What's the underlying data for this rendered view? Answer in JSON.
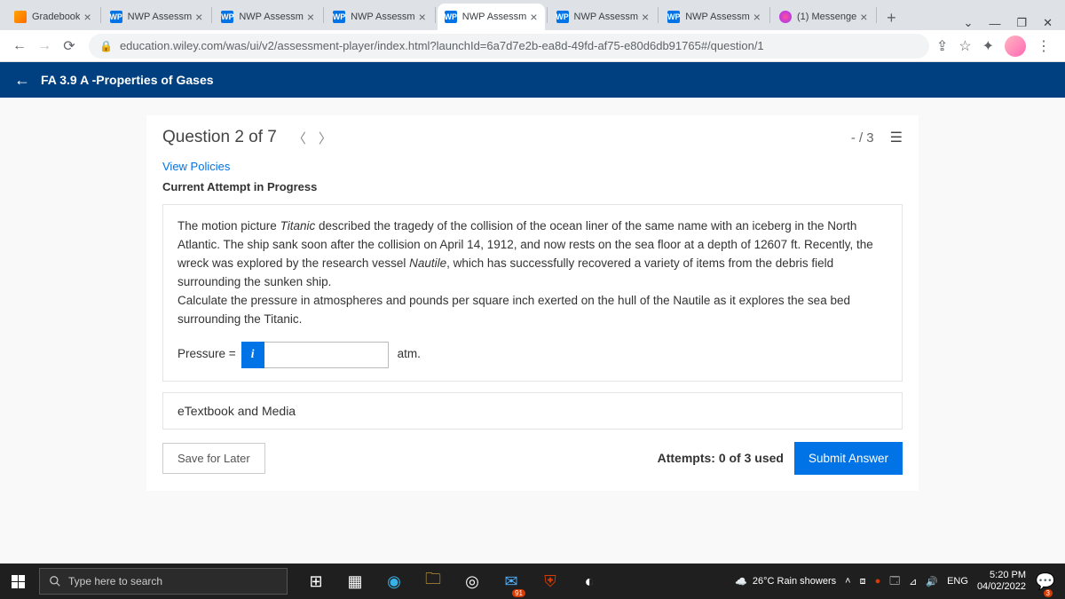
{
  "tabs": [
    {
      "title": "Gradebook",
      "favicon": "grade"
    },
    {
      "title": "NWP Assessm",
      "favicon": "wp"
    },
    {
      "title": "NWP Assessm",
      "favicon": "wp"
    },
    {
      "title": "NWP Assessm",
      "favicon": "wp"
    },
    {
      "title": "NWP Assessm",
      "favicon": "wp",
      "active": true
    },
    {
      "title": "NWP Assessm",
      "favicon": "wp"
    },
    {
      "title": "NWP Assessm",
      "favicon": "wp"
    },
    {
      "title": "(1) Messenge",
      "favicon": "msg"
    }
  ],
  "url": "education.wiley.com/was/ui/v2/assessment-player/index.html?launchId=6a7d7e2b-ea8d-49fd-af75-e80d6db91765#/question/1",
  "assessment_title": "FA 3.9 A -Properties of Gases",
  "question": {
    "header": "Question 2 of 7",
    "score": "- / 3",
    "policies_link": "View Policies",
    "attempt_label": "Current Attempt in Progress",
    "paragraph1_a": "The motion picture ",
    "paragraph1_em1": "Titanic",
    "paragraph1_b": " described the tragedy of the collision of the ocean liner of the same name with an iceberg in the North Atlantic. The ship sank soon after the collision on April 14, 1912, and now rests on the sea floor at a depth of 12607 ft. Recently, the wreck was explored by the research vessel ",
    "paragraph1_em2": "Nautile",
    "paragraph1_c": ", which has successfully recovered a variety of items from the debris field surrounding the sunken ship.",
    "paragraph2": "Calculate the pressure in atmospheres and pounds per square inch exerted on the hull of the Nautile as it explores the sea bed surrounding the Titanic.",
    "answer_label": "Pressure =",
    "answer_unit": "atm.",
    "etextbook_label": "eTextbook and Media",
    "save_label": "Save for Later",
    "attempts_label": "Attempts: 0 of 3 used",
    "submit_label": "Submit Answer"
  },
  "taskbar": {
    "search_placeholder": "Type here to search",
    "weather": "26°C  Rain showers",
    "lang": "ENG",
    "time": "5:20 PM",
    "date": "04/02/2022",
    "mail_badge": "91",
    "notif_badge": "3"
  }
}
